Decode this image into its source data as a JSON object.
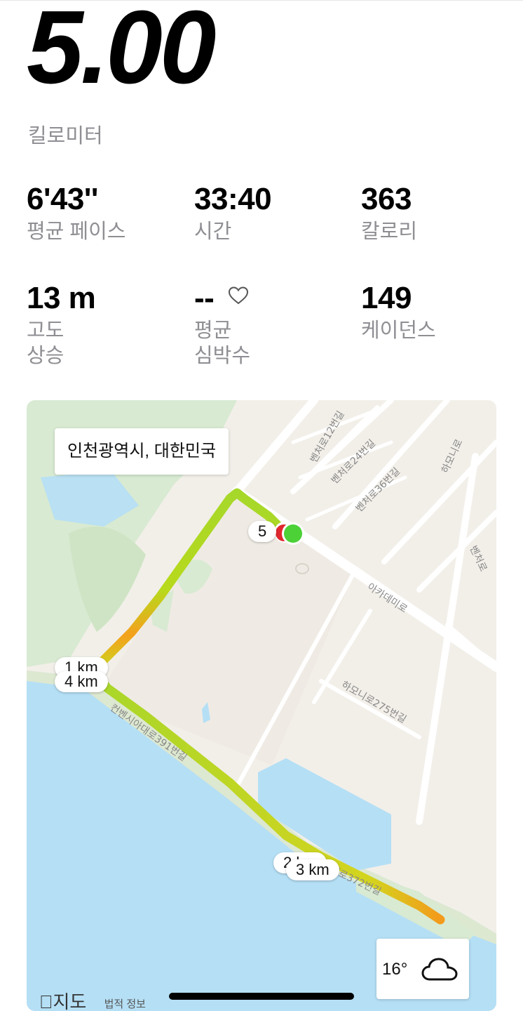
{
  "distance": {
    "value": "5.00",
    "unit": "킬로미터"
  },
  "stats": {
    "avg_pace": {
      "value": "6'43''",
      "label": "평균 페이스"
    },
    "time": {
      "value": "33:40",
      "label": "시간"
    },
    "calories": {
      "value": "363",
      "label": "칼로리"
    },
    "elevation": {
      "value": "13 m",
      "label_line1": "고도",
      "label_line2": "상승"
    },
    "heart_rate": {
      "value": "--",
      "label_line1": "평균",
      "label_line2": "심박수",
      "icon": "heart-outline-icon"
    },
    "cadence": {
      "value": "149",
      "label": "케이던스"
    }
  },
  "map": {
    "location": "인천광역시, 대한민국",
    "markers": {
      "km1": "1 km",
      "km2": "2 km",
      "km3": "3 km",
      "km4": "4 km",
      "km5": "5"
    },
    "streets": {
      "s1": "벤처로12번길",
      "s2": "벤처로24번길",
      "s3": "벤처로36번길",
      "s4": "하모니로",
      "s5": "벤처로",
      "s6": "아카데미로",
      "s7": "하모니로275번길",
      "s8": "컨벤시아대로391번길",
      "s9": "대로372번길"
    },
    "weather": {
      "temp": "16°",
      "icon": "cloud-icon"
    },
    "attribution": {
      "logo": "지도",
      "legal": "법적 정보"
    },
    "colors": {
      "water": "#b5dff5",
      "park": "#d8ead2",
      "land": "#f2efe9",
      "route_green": "#9ed62f",
      "route_yellow": "#f5d020",
      "route_orange": "#f28a1e",
      "start": "#4cd137",
      "end": "#e0282e"
    }
  }
}
